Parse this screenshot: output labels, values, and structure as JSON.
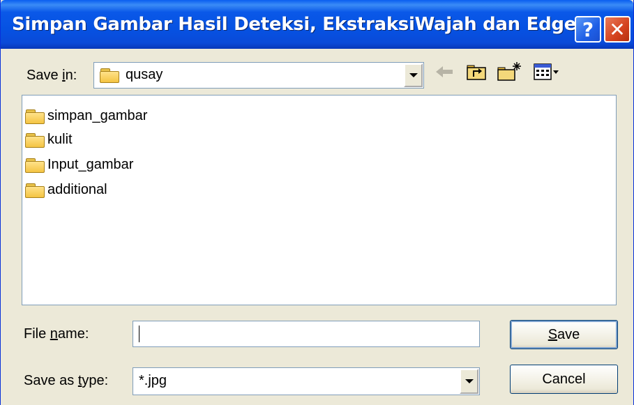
{
  "window": {
    "title": "Simpan Gambar Hasil Deteksi, EkstraksiWajah dan Edge",
    "help_label": "?",
    "close_label": "✕"
  },
  "save_in": {
    "label_pre": "Save ",
    "label_accel": "i",
    "label_post": "n:",
    "value": "qusay"
  },
  "toolbar": {
    "back_icon": "back-arrow-icon",
    "up_icon": "up-folder-icon",
    "new_folder_icon": "new-folder-icon",
    "view_icon": "view-menu-icon"
  },
  "files": [
    {
      "name": "simpan_gambar"
    },
    {
      "name": "kulit"
    },
    {
      "name": "Input_gambar"
    },
    {
      "name": "additional"
    }
  ],
  "file_name": {
    "label_pre": "File ",
    "label_accel": "n",
    "label_post": "ame:",
    "value": ""
  },
  "save_as_type": {
    "label_pre": "Save as ",
    "label_accel": "t",
    "label_post": "ype:",
    "value": "*.jpg"
  },
  "buttons": {
    "save_accel": "S",
    "save_rest": "ave",
    "cancel": "Cancel"
  }
}
